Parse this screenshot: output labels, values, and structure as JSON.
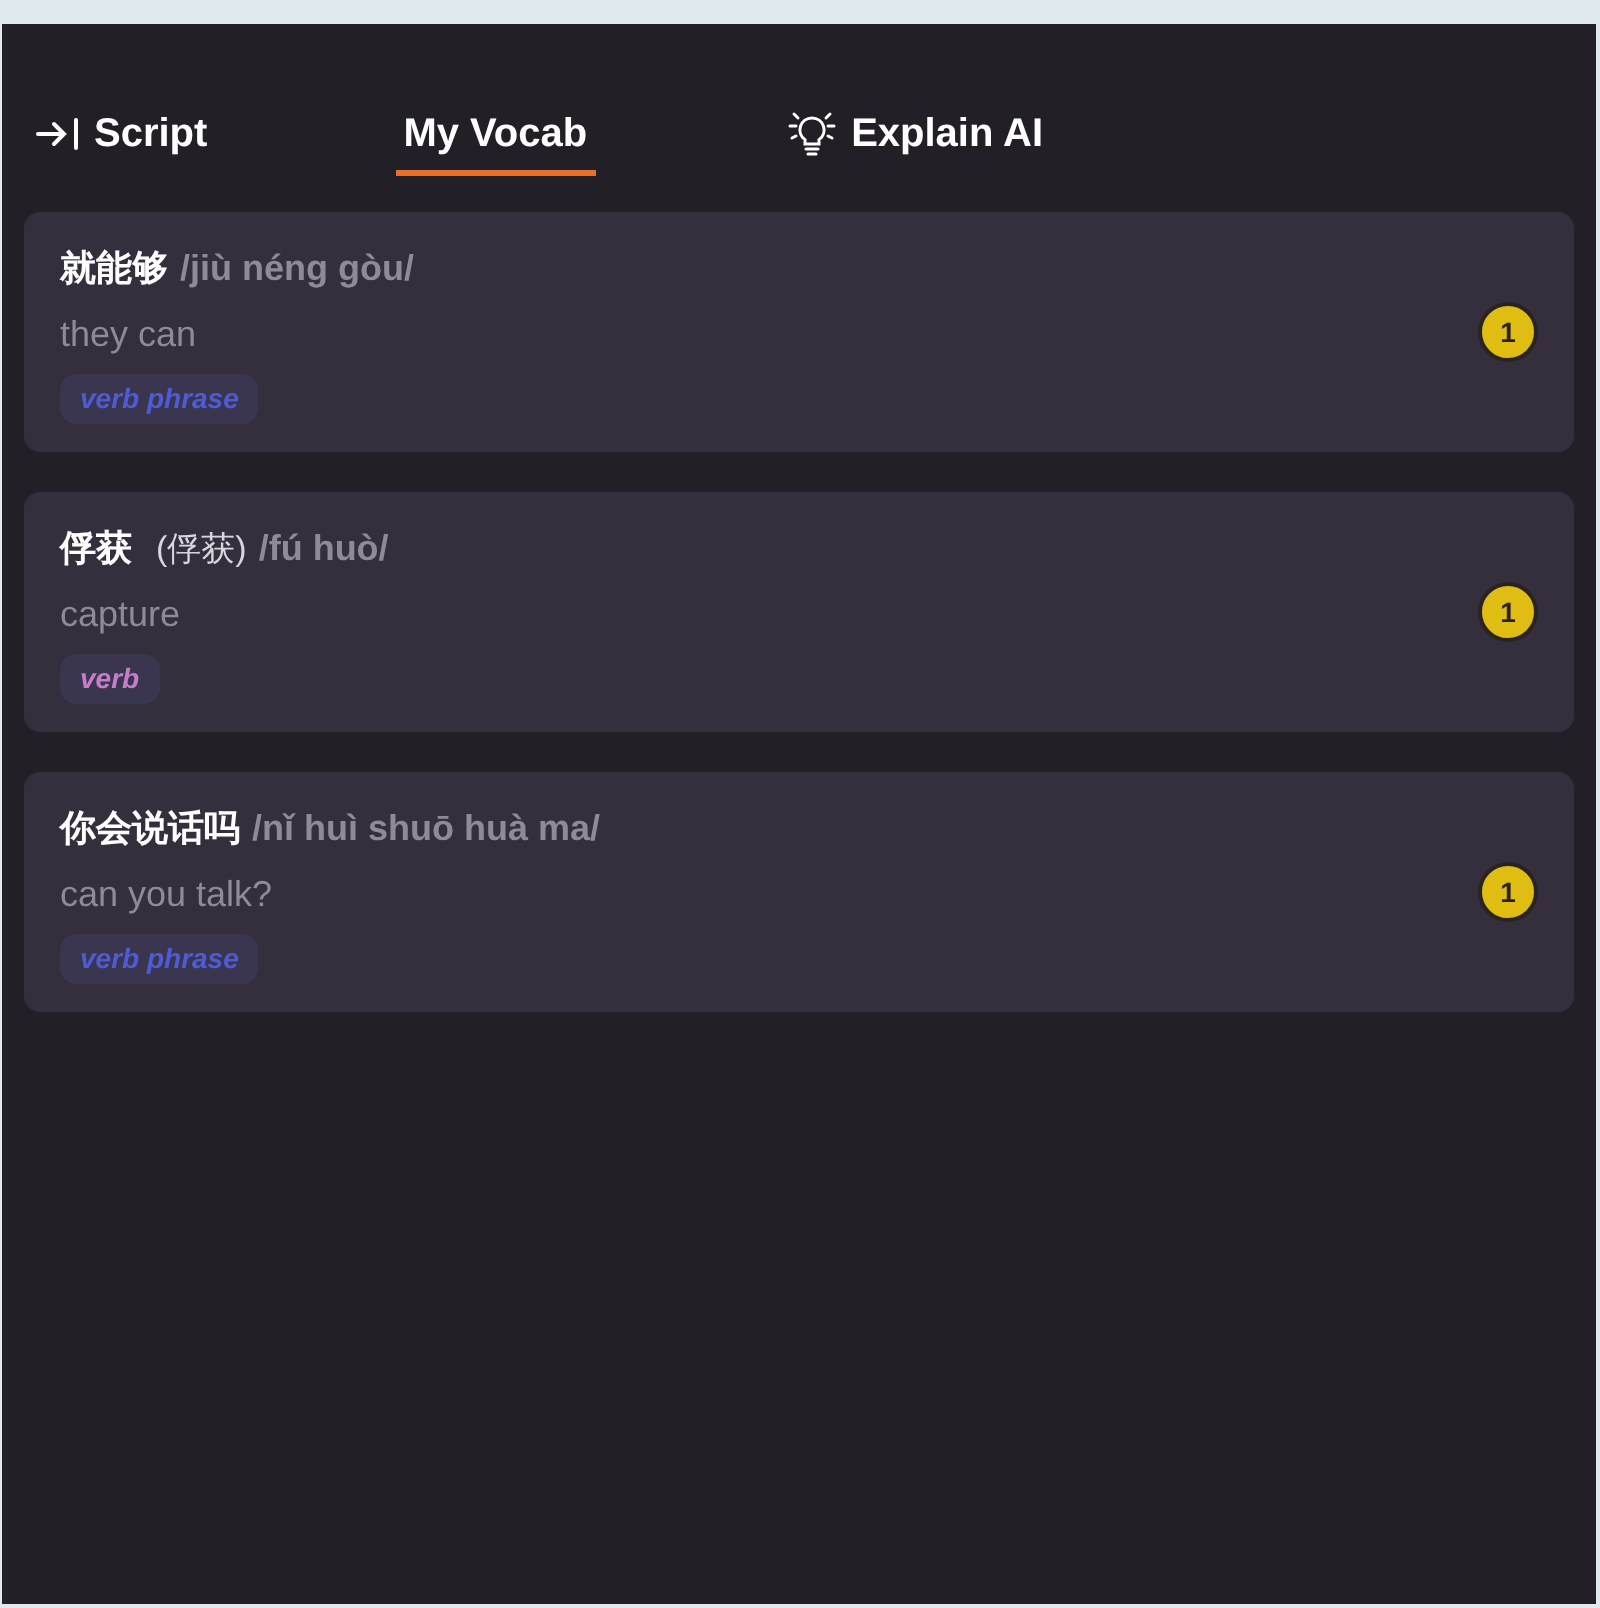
{
  "tabs": [
    {
      "label": "Script",
      "kind": "panel-toggle",
      "selected": false
    },
    {
      "label": "My Vocab",
      "kind": "plain",
      "selected": true
    },
    {
      "label": "Explain AI",
      "kind": "ai",
      "selected": false
    }
  ],
  "vocab": [
    {
      "word": "就能够",
      "pinyin": "/jiù néng gòu/",
      "meaning": "they can",
      "tag": {
        "label": "verb phrase",
        "color": "#4f5bd5"
      },
      "count": "1"
    },
    {
      "word": "俘获",
      "traditional": "(俘获)",
      "pinyin": "/fú huò/",
      "meaning": "capture",
      "tag": {
        "label": "verb",
        "color": "#c77dc9"
      },
      "count": "1"
    },
    {
      "word": "你会说话吗",
      "pinyin": "/nǐ huì shuō huà ma/",
      "meaning": "can you talk?",
      "tag": {
        "label": "verb phrase",
        "color": "#4f5bd5"
      },
      "count": "1"
    }
  ]
}
